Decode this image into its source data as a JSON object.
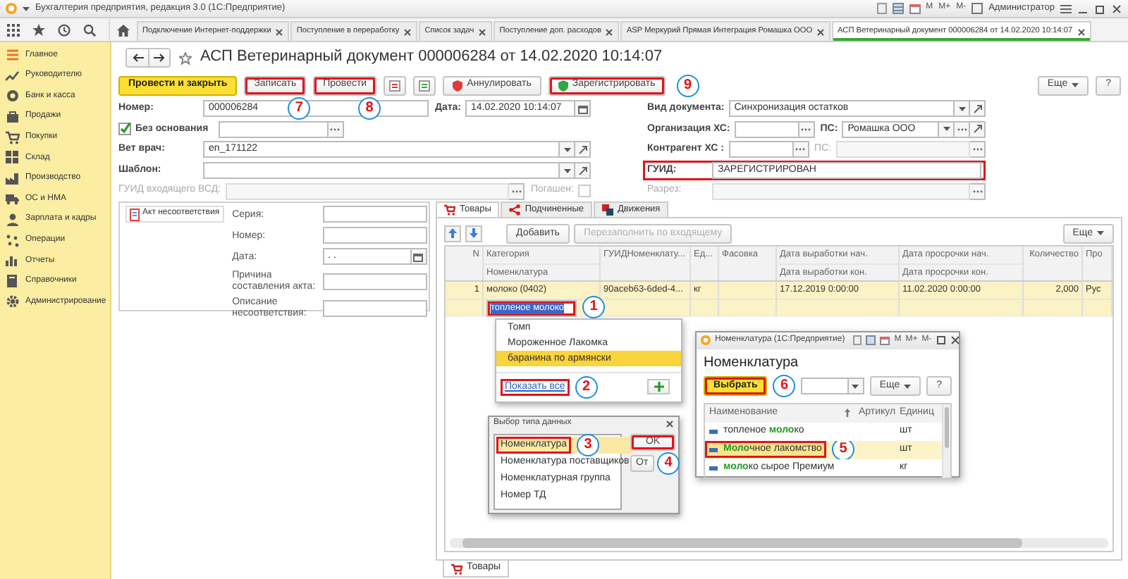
{
  "window": {
    "title": "Бухгалтерия предприятия, редакция 3.0 (1С:Предприятие)",
    "memory_buttons": [
      "M",
      "M+",
      "M-"
    ],
    "user": "Администратор"
  },
  "open_tabs": [
    {
      "label": "Подключение Интернет-поддержки",
      "selected": false
    },
    {
      "label": "Поступление в переработку",
      "selected": false
    },
    {
      "label": "Список задач",
      "selected": false
    },
    {
      "label": "Поступление доп. расходов",
      "selected": false
    },
    {
      "label": "ASP Меркурий Прямая Интеграция Ромашка ООО",
      "selected": false
    },
    {
      "label": "АСП Ветеринарный документ 000006284 от 14.02.2020 10:14:07",
      "selected": true
    }
  ],
  "sidebar": {
    "items": [
      {
        "label": "Главное"
      },
      {
        "label": "Руководителю"
      },
      {
        "label": "Банк и касса"
      },
      {
        "label": "Продажи"
      },
      {
        "label": "Покупки"
      },
      {
        "label": "Склад"
      },
      {
        "label": "Производство"
      },
      {
        "label": "ОС и НМА"
      },
      {
        "label": "Зарплата и кадры"
      },
      {
        "label": "Операции"
      },
      {
        "label": "Отчеты"
      },
      {
        "label": "Справочники"
      },
      {
        "label": "Администрирование"
      }
    ]
  },
  "document": {
    "title": "АСП Ветеринарный документ 000006284 от 14.02.2020 10:14:07",
    "toolbar": [
      {
        "kind": "primary",
        "label": "Провести и закрыть",
        "highlighted": false
      },
      {
        "kind": "button",
        "label": "Записать",
        "highlighted": true,
        "callout": "7"
      },
      {
        "kind": "button",
        "label": "Провести",
        "highlighted": true,
        "callout": "8"
      },
      {
        "kind": "icon",
        "highlighted": false
      },
      {
        "kind": "icon",
        "highlighted": false
      },
      {
        "kind": "shield",
        "label": "Аннулировать",
        "color": "#e03a3a",
        "highlighted": false
      },
      {
        "kind": "shield",
        "label": "Зарегистрировать",
        "color": "#2ea84a",
        "highlighted": true,
        "callout": "9"
      }
    ],
    "more_button": "Еще",
    "help_button": "?",
    "form_rows": [
      {
        "left": [
          {
            "kind": "text",
            "label": "Номер:",
            "value": "000006284",
            "disabled": false
          },
          {
            "kind": "date",
            "label": "Дата:",
            "value": "14.02.2020 10:14:07",
            "disabled": false
          }
        ],
        "right": [
          {
            "kind": "select",
            "label": "Вид документа:",
            "value": "Синхронизация остатков",
            "disabled": false
          }
        ]
      },
      {
        "left": [
          {
            "kind": "checkbox",
            "label": "Без основания",
            "checked": true
          },
          {
            "kind": "choice",
            "disabled": false
          }
        ],
        "right": [
          {
            "kind": "choice",
            "label": "Организация ХС:",
            "disabled": false
          },
          {
            "kind": "select-choice",
            "label": "ПС:",
            "value": "Ромашка ООО",
            "disabled": false
          }
        ]
      },
      {
        "left": [
          {
            "kind": "select",
            "label": "Вет врач:",
            "value": "en_171122",
            "disabled": false
          }
        ],
        "right": [
          {
            "kind": "choice",
            "label": "Контрагент ХС :",
            "disabled": false
          },
          {
            "kind": "choice",
            "label": "ПС:",
            "disabled": true
          }
        ]
      },
      {
        "left": [
          {
            "kind": "select",
            "label": "Шаблон:",
            "disabled": false
          }
        ],
        "right": [
          {
            "kind": "text",
            "label": "ГУИД:",
            "value": "ЗАРЕГИСТРИРОВАН",
            "disabled": false,
            "highlighted": true
          }
        ]
      },
      {
        "left": [
          {
            "kind": "choice",
            "label": "ГУИД входящего ВСД:",
            "disabled": true
          },
          {
            "kind": "tickbox",
            "label": "Погашен:",
            "checked": false,
            "disabled": true
          }
        ],
        "right": [
          {
            "kind": "choice",
            "label": "Разрез:",
            "disabled": true
          }
        ]
      }
    ],
    "act": {
      "tab": "Акт несоответствия",
      "fields": [
        {
          "label": "Серия:",
          "kind": "text"
        },
        {
          "label": "Номер:",
          "kind": "text"
        },
        {
          "label": "Дата:",
          "kind": "date",
          "value": ". ."
        },
        {
          "label": "Причина составления акта:",
          "kind": "text"
        },
        {
          "label": "Описание несоответствия:",
          "kind": "text"
        }
      ]
    },
    "goods": {
      "tabs": [
        {
          "label": "Товары",
          "selected": true
        },
        {
          "label": "Подчиненные",
          "selected": false
        },
        {
          "label": "Движения",
          "selected": false
        }
      ],
      "toolbar": [
        {
          "kind": "up"
        },
        {
          "kind": "down"
        },
        {
          "kind": "button",
          "label": "Добавить",
          "disabled": false
        },
        {
          "kind": "button",
          "label": "Перезаполнить по входящему",
          "disabled": true
        }
      ],
      "more_button": "Еще",
      "columns": [
        {
          "lines": [
            "N"
          ],
          "kind": "number"
        },
        {
          "lines": [
            "Категория",
            "Номенклатура"
          ],
          "kind": "text"
        },
        {
          "lines": [
            "ГУИДНоменклату..."
          ],
          "kind": "text"
        },
        {
          "lines": [
            "Ед..."
          ],
          "kind": "text"
        },
        {
          "lines": [
            "Фасовка"
          ],
          "kind": "text"
        },
        {
          "lines": [
            "Дата выработки нач.",
            "Дата выработки кон."
          ],
          "kind": "text"
        },
        {
          "lines": [
            "Дата просрочки нач.",
            "Дата просрочки кон."
          ],
          "kind": "text"
        },
        {
          "lines": [
            "Количество"
          ],
          "kind": "number"
        },
        {
          "lines": [
            "Про"
          ],
          "kind": "text"
        }
      ],
      "rows": [
        {
          "selected": true,
          "cells": [
            {
              "lines": [
                "1"
              ]
            },
            {
              "lines": [
                "молоко (0402)"
              ],
              "editor": {
                "value": "топленое молоко",
                "highlighted": true,
                "callout": "1"
              }
            },
            {
              "lines": [
                "90aceb63-6ded-4..."
              ]
            },
            {
              "lines": [
                "кг"
              ]
            },
            {},
            {
              "lines": [
                "17.12.2019 0:00:00"
              ]
            },
            {
              "lines": [
                "11.02.2020 0:00:00"
              ]
            },
            {
              "lines": [
                "2,000"
              ]
            },
            {
              "lines": [
                "Рус"
              ]
            }
          ]
        }
      ],
      "dropdown": {
        "items": [
          {
            "label": "Томп",
            "selected": false
          },
          {
            "label": "Мороженное Лакомка",
            "selected": false
          },
          {
            "label": "баранина по армянски",
            "selected": true
          }
        ],
        "show_all": {
          "label": "Показать все",
          "highlighted": true,
          "callout": "2"
        }
      },
      "type_dialog": {
        "title": "Выбор типа данных",
        "items": [
          {
            "label": "Номенклатура",
            "selected": true,
            "highlighted": true,
            "callout": "3"
          },
          {
            "label": "Номенклатура поставщиков",
            "selected": false,
            "highlighted": false
          },
          {
            "label": "Номенклатурная группа",
            "selected": false,
            "highlighted": false
          },
          {
            "label": "Номер ТД",
            "selected": false,
            "highlighted": false
          }
        ],
        "buttons": [
          {
            "label": "OK",
            "highlighted": true,
            "callout": "4"
          },
          {
            "label": "От",
            "highlighted": false
          }
        ]
      },
      "nomenclature_dialog": {
        "title": "Номенклатура (1С:Предприятие)",
        "memory_buttons": [
          "M",
          "M+",
          "M-"
        ],
        "heading": "Номенклатура",
        "select_button": {
          "label": "Выбрать",
          "highlighted": true,
          "callout": "6"
        },
        "more_button": "Еще",
        "help_button": "?",
        "columns": [
          "Наименование",
          "Артикул",
          "Единиц"
        ],
        "rows": [
          {
            "name": "топленое **моло**ко",
            "unit": "шт",
            "selected": false,
            "highlighted": false
          },
          {
            "name": "**Моло**чное лакомство",
            "unit": "шт",
            "selected": true,
            "highlighted": true,
            "callout": "5"
          },
          {
            "name": "**моло**ко сырое Премиум",
            "unit": "кг",
            "selected": false,
            "highlighted": false
          }
        ]
      },
      "bottom_tabs": [
        {
          "label": "Товары",
          "selected": true
        }
      ]
    }
  }
}
